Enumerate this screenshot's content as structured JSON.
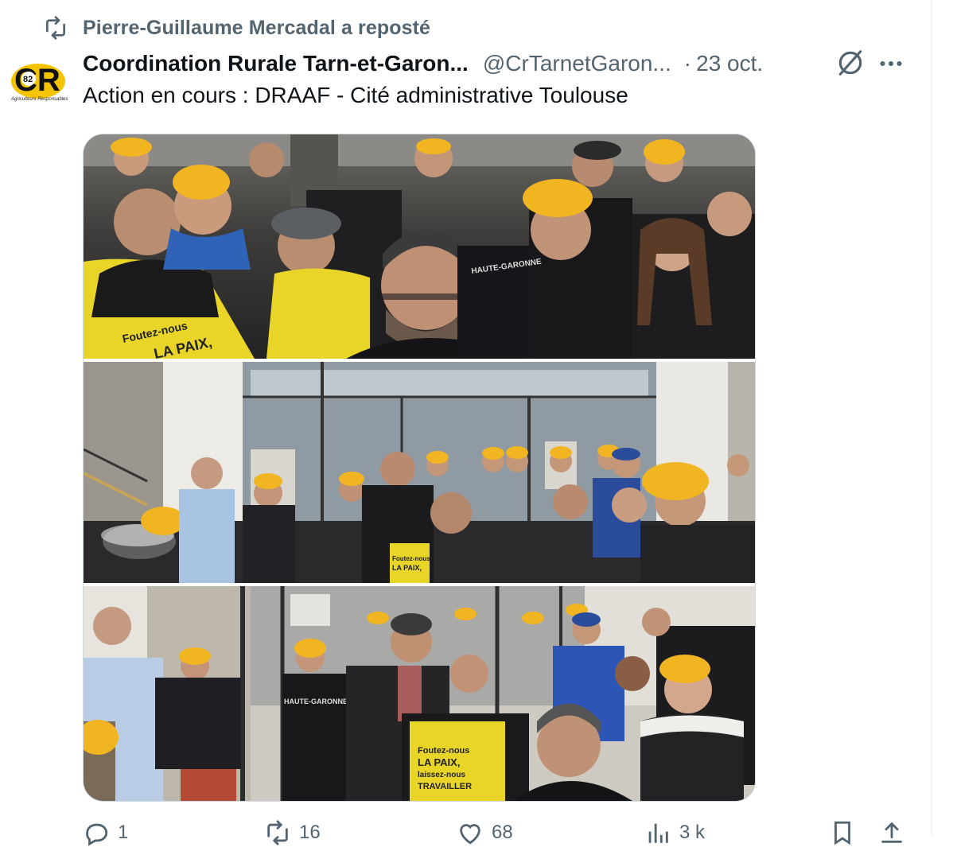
{
  "repost": {
    "text": "Pierre-Guillaume Mercadal a reposté"
  },
  "tweet": {
    "author_name": "Coordination Rurale Tarn-et-Garon...",
    "handle": "@CrTarnetGaron...",
    "separator": "·",
    "date": "23 oct.",
    "text": "Action en cours : DRAAF - Cité administrative Toulouse",
    "avatar_logo_text": "CR",
    "avatar_logo_number": "82",
    "avatar_logo_tagline": "Agriculteurs Responsables"
  },
  "media": {
    "photo_texts": {
      "vest_slogan_line1": "Foutez-nous",
      "vest_slogan_line2": "LA PAIX,",
      "vest_slogan_line3": "laissez-nous",
      "vest_slogan_line4": "TRAVAILLER",
      "jacket_text": "HAUTE-GARONNE"
    }
  },
  "actions": {
    "replies": "1",
    "reposts": "16",
    "likes": "68",
    "views": "3 k"
  },
  "colors": {
    "secondary_text": "#536471",
    "primary_text": "#0f1419",
    "cap_yellow": "#f2b522",
    "vest_yellow": "#e8d528"
  }
}
